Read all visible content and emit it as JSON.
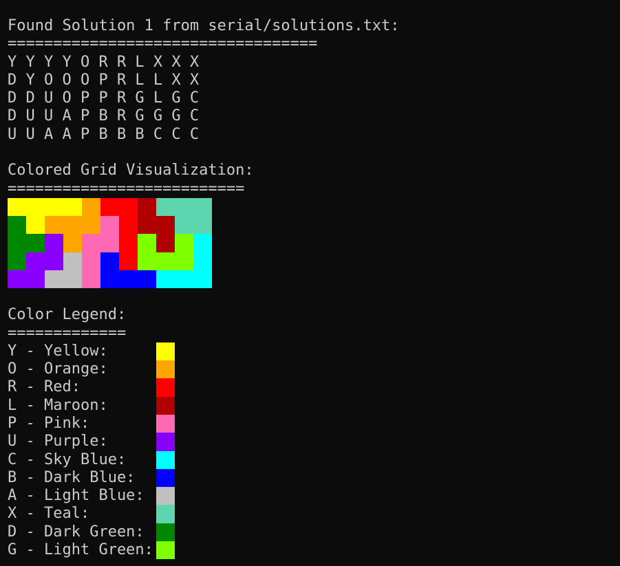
{
  "header": {
    "found_line": "Found Solution 1 from serial/solutions.txt:",
    "found_rule": "=================================="
  },
  "solution_rows": [
    "Y Y Y Y O R R L X X X",
    "D Y O O O P R L L X X",
    "D D U O P P R G L G C",
    "D U U A P B R G G G C",
    "U U A A P B B B C C C"
  ],
  "grid_section": {
    "title": "Colored Grid Visualization:",
    "rule": "=========================="
  },
  "colors": {
    "Y": "#ffff00",
    "O": "#ffa500",
    "R": "#ff0000",
    "L": "#b00000",
    "P": "#ff69b4",
    "U": "#8a00ff",
    "C": "#00ffff",
    "B": "#0000ff",
    "A": "#c0c0c0",
    "X": "#5dd6b0",
    "D": "#008800",
    "G": "#80ff00"
  },
  "legend_section": {
    "title": "Color Legend:",
    "rule": "=============",
    "items": [
      {
        "code": "Y",
        "label": "Y - Yellow:"
      },
      {
        "code": "O",
        "label": "O - Orange:"
      },
      {
        "code": "R",
        "label": "R - Red:"
      },
      {
        "code": "L",
        "label": "L - Maroon:"
      },
      {
        "code": "P",
        "label": "P - Pink:"
      },
      {
        "code": "U",
        "label": "U - Purple:"
      },
      {
        "code": "C",
        "label": "C - Sky Blue:"
      },
      {
        "code": "B",
        "label": "B - Dark Blue:"
      },
      {
        "code": "A",
        "label": "A - Light Blue:"
      },
      {
        "code": "X",
        "label": "X - Teal:"
      },
      {
        "code": "D",
        "label": "D - Dark Green:"
      },
      {
        "code": "G",
        "label": "G - Light Green:"
      }
    ]
  }
}
